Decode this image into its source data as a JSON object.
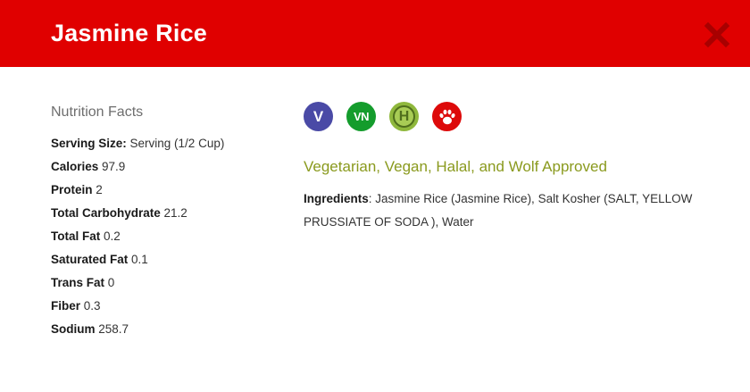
{
  "header": {
    "title": "Jasmine Rice",
    "close_icon": "close-x-icon",
    "background_color": "#e00000"
  },
  "nutrition": {
    "title": "Nutrition Facts",
    "rows": [
      {
        "label": "Serving Size:",
        "value": " Serving (1/2 Cup)"
      },
      {
        "label": "Calories",
        "value": " 97.9"
      },
      {
        "label": "Protein",
        "value": " 2"
      },
      {
        "label": "Total Carbohydrate",
        "value": " 21.2"
      },
      {
        "label": "Total Fat",
        "value": " 0.2"
      },
      {
        "label": "Saturated Fat",
        "value": " 0.1"
      },
      {
        "label": "Trans Fat",
        "value": " 0"
      },
      {
        "label": "Fiber",
        "value": " 0.3"
      },
      {
        "label": "Sodium",
        "value": " 258.7"
      }
    ]
  },
  "dietary": {
    "icons": [
      {
        "name": "vegetarian-icon",
        "text": "V",
        "color": "#4a4aa6"
      },
      {
        "name": "vegan-icon",
        "text": "VN",
        "color": "#149c2c"
      },
      {
        "name": "halal-icon",
        "text": "H",
        "color": "#8fb83c"
      },
      {
        "name": "wolf-approved-paw-icon",
        "color": "#dd0a0a"
      }
    ],
    "approved_text": "Vegetarian, Vegan, Halal, and Wolf Approved",
    "approved_color": "#8a9a1e"
  },
  "ingredients": {
    "label": "Ingredients",
    "text": ": Jasmine Rice (Jasmine Rice), Salt Kosher (SALT, YELLOW PRUSSIATE OF SODA ), Water"
  }
}
